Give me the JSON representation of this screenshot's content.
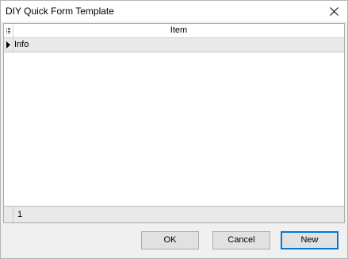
{
  "window": {
    "title": "DIY Quick Form Template",
    "close_icon": "close-icon"
  },
  "grid": {
    "column_header": "Item",
    "rows": [
      {
        "item": "Info",
        "selected": true
      }
    ],
    "footer": {
      "count": "1"
    }
  },
  "buttons": {
    "ok": "OK",
    "cancel": "Cancel",
    "new": "New"
  }
}
